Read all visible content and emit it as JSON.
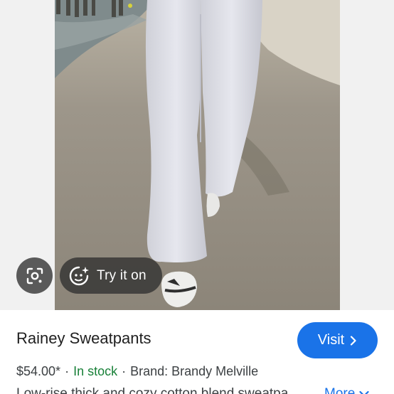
{
  "image": {
    "lens_icon": "lens-camera-icon",
    "try_on": {
      "label": "Try it on",
      "icon": "sparkle-face-icon"
    }
  },
  "product": {
    "title": "Rainey Sweatpants",
    "visit_label": "Visit",
    "price": "$54.00*",
    "separator": "·",
    "stock": "In stock",
    "brand": "Brand: Brandy Melville",
    "description": "Low-rise thick and cozy cotton blend sweatpa",
    "more_label": "More"
  },
  "colors": {
    "accent": "#1a73e8",
    "in_stock": "#188038"
  }
}
